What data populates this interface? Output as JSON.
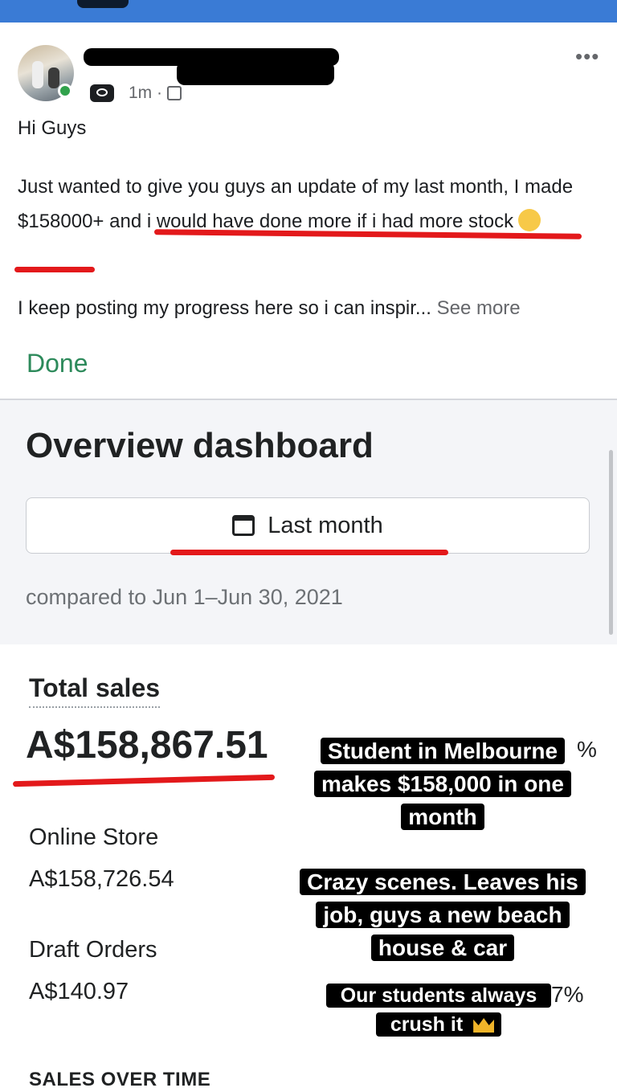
{
  "post": {
    "time": "1m",
    "more_icon": "ellipsis-icon",
    "greeting": "Hi Guys",
    "body": "Just wanted to give you guys an update of my last month, I made $158000+ and i would have done more if i had more stock",
    "body_emoji": "tears-of-joy-emoji",
    "teaser": "I keep posting my progress here so i can inspir...",
    "see_more": "See more",
    "done": "Done"
  },
  "dashboard": {
    "title": "Overview dashboard",
    "date_range": "Last month",
    "compared": "compared to Jun 1–Jun 30, 2021"
  },
  "metrics": {
    "total_sales_label": "Total sales",
    "total_sales_value": "A$158,867.51",
    "online_store_label": "Online Store",
    "online_store_value": "A$158,726.54",
    "draft_orders_label": "Draft Orders",
    "draft_orders_value": "A$140.97",
    "sales_over_time_label": "SALES OVER TIME",
    "partial_pct_1": "%",
    "partial_pct_2": "7%"
  },
  "captions": {
    "caption1": "Student in Melbourne makes $158,000 in one month",
    "caption2": "Crazy scenes. Leaves his job, guys a new beach house & car",
    "caption3": "Our students always crush it",
    "caption3_icon": "crown-emoji"
  },
  "colors": {
    "accent_green": "#2d8a5b",
    "annotation_red": "#e3191b",
    "top_bar_blue": "#3a7bd5"
  }
}
